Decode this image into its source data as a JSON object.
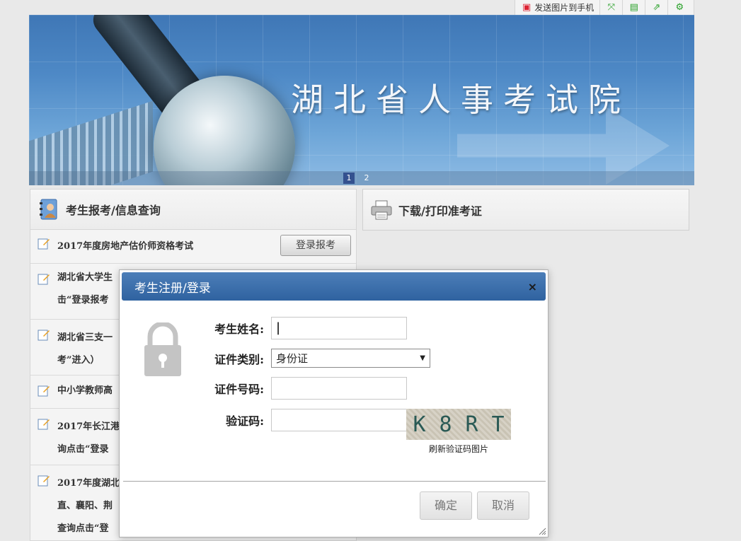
{
  "toolbar": {
    "send_to_phone_label": "发送图片到手机"
  },
  "banner": {
    "title": "湖北省人事考试院",
    "pages": [
      "1",
      "2"
    ],
    "active_page": "1"
  },
  "left_panel": {
    "title": "考生报考/信息查询",
    "rows": [
      {
        "text": "2017年度房地产估价师资格考试",
        "button": "登录报考"
      },
      {
        "text_line1": "湖北省大学生",
        "text_line2": "击“登录报考"
      },
      {
        "text_line1": "湖北省三支一",
        "text_line2": "考”进入）"
      },
      {
        "text": "中小学教师高"
      },
      {
        "text_line1": "2017年长江港",
        "text_line2": "询点击“登录"
      },
      {
        "text_line1": "2017年度湖北",
        "text_line2": "直、襄阳、荆",
        "text_line3": "查询点击“登"
      }
    ]
  },
  "right_panel": {
    "title": "下载/打印准考证"
  },
  "modal": {
    "title": "考生注册/登录",
    "close": "×",
    "fields": {
      "name_label": "考生姓名:",
      "id_type_label": "证件类别:",
      "id_type_value": "身份证",
      "id_number_label": "证件号码:",
      "captcha_label": "验证码:"
    },
    "captcha_text": [
      "K",
      "8",
      "R",
      "T"
    ],
    "captcha_refresh": "刷新验证码图片",
    "confirm": "确定",
    "cancel": "取消"
  }
}
